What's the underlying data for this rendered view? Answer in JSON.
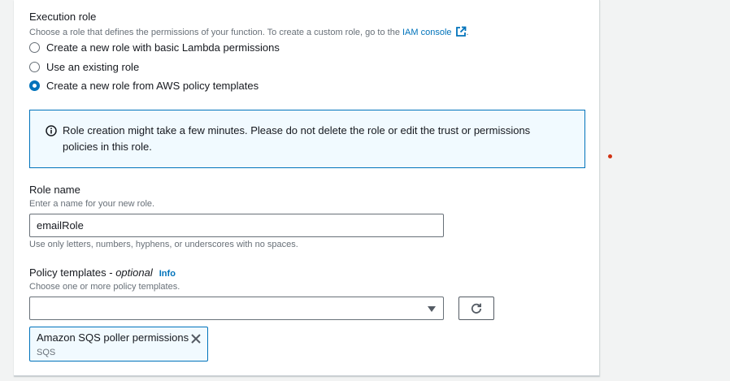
{
  "execution_role": {
    "label": "Execution role",
    "description_prefix": "Choose a role that defines the permissions of your function. To create a custom role, go to the ",
    "iam_link": "IAM console",
    "description_suffix": ".",
    "options": [
      {
        "label": "Create a new role with basic Lambda permissions",
        "checked": false
      },
      {
        "label": "Use an existing role",
        "checked": false
      },
      {
        "label": "Create a new role from AWS policy templates",
        "checked": true
      }
    ]
  },
  "alert": {
    "icon": "info-icon",
    "text": "Role creation might take a few minutes. Please do not delete the role or edit the trust or permissions policies in this role."
  },
  "role_name": {
    "label": "Role name",
    "description": "Enter a name for your new role.",
    "value": "emailRole",
    "constraint": "Use only letters, numbers, hyphens, or underscores with no spaces."
  },
  "policy_templates": {
    "label": "Policy templates - ",
    "optional": "optional",
    "info_link": "Info",
    "description": "Choose one or more policy templates.",
    "select_value": "",
    "selected_tokens": [
      {
        "label": "Amazon SQS poller permissions",
        "sub": "SQS"
      }
    ]
  },
  "colors": {
    "accent": "#0073bb",
    "alert_bg": "#f1faff",
    "indicator": "#d13212"
  }
}
